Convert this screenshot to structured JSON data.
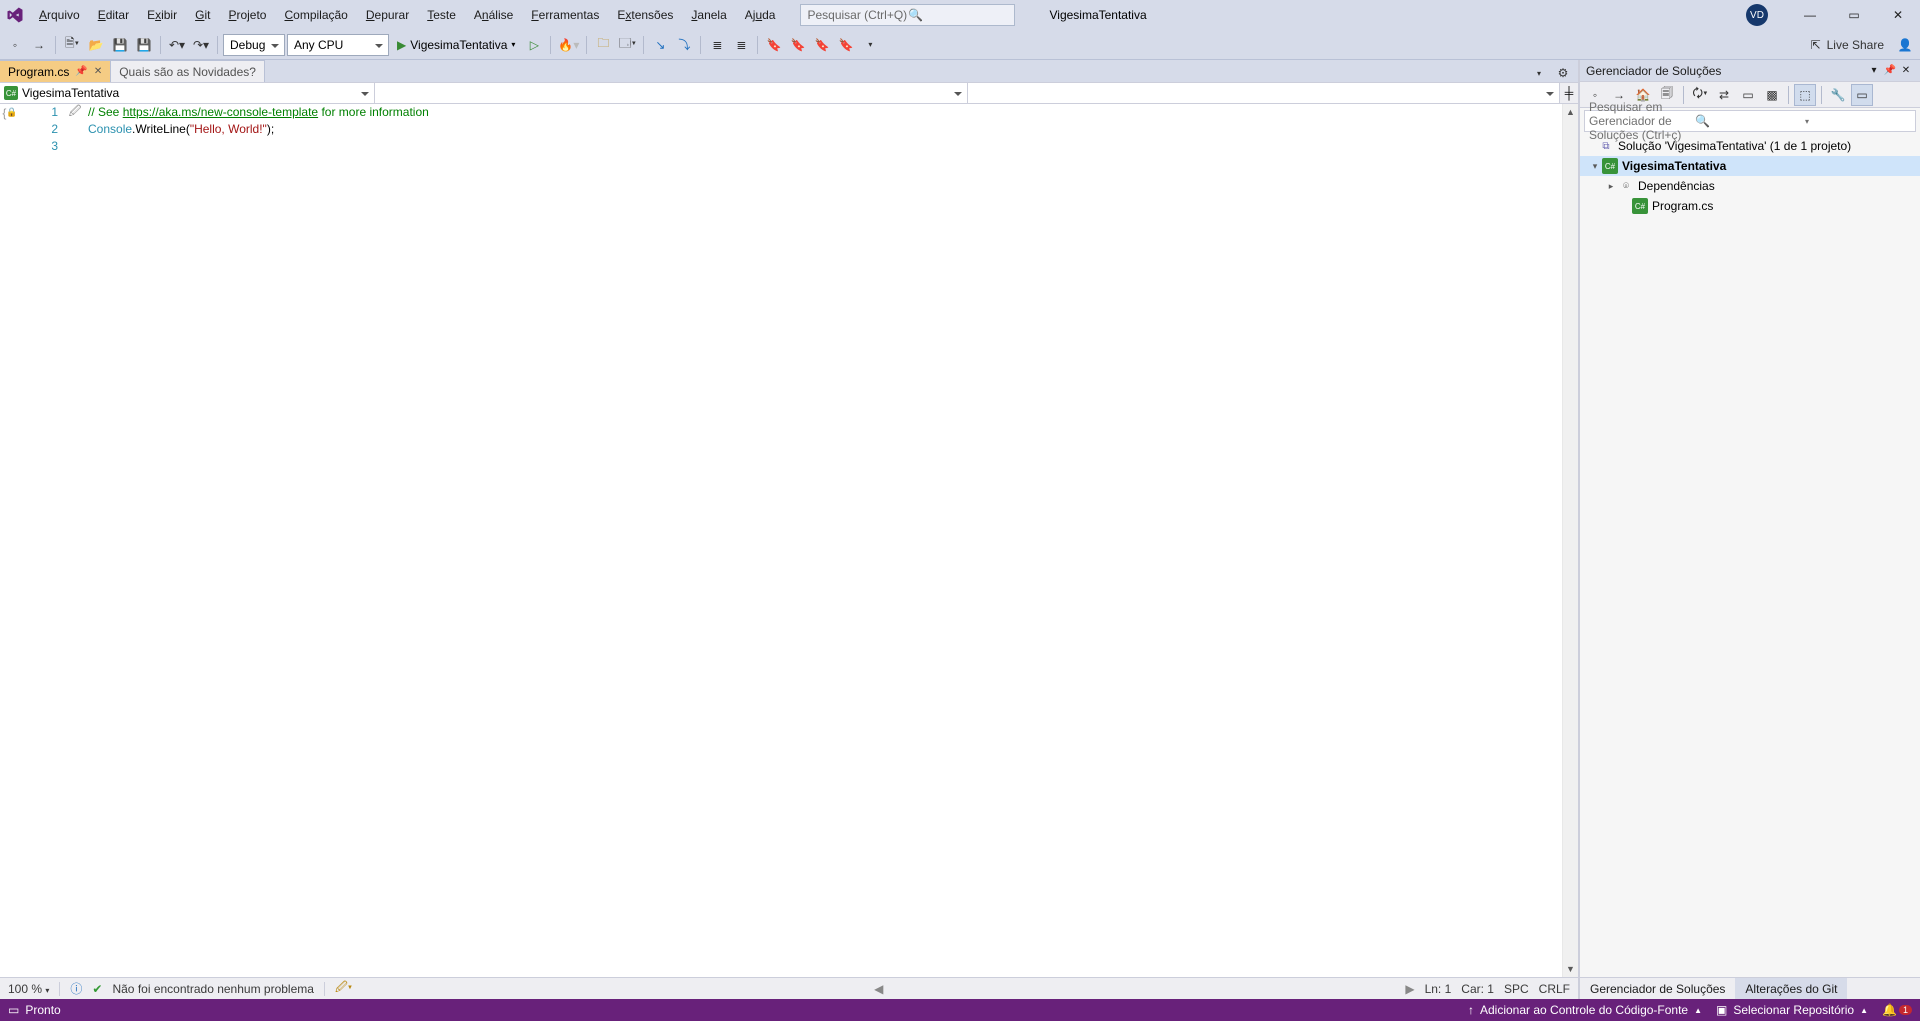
{
  "menu": [
    "Arquivo",
    "Editar",
    "Exibir",
    "Git",
    "Projeto",
    "Compilação",
    "Depurar",
    "Teste",
    "Análise",
    "Ferramentas",
    "Extensões",
    "Janela",
    "Ajuda"
  ],
  "search_placeholder": "Pesquisar (Ctrl+Q)",
  "project_title": "VigesimaTentativa",
  "avatar": "VD",
  "toolbar": {
    "config": "Debug",
    "platform": "Any CPU",
    "run_target": "VigesimaTentativa",
    "live_share": "Live Share"
  },
  "tabs": [
    {
      "label": "Program.cs",
      "active": true,
      "pinned": true
    },
    {
      "label": "Quais são as Novidades?",
      "active": false
    }
  ],
  "nav_combo": "VigesimaTentativa",
  "code": {
    "lines": [
      "1",
      "2",
      "3"
    ],
    "l1_prefix": "// See ",
    "l1_url": "https://aka.ms/new-console-template",
    "l1_suffix": " for more information",
    "l2_class": "Console",
    "l2_mid": ".WriteLine(",
    "l2_str": "\"Hello, World!\"",
    "l2_end": ");"
  },
  "editor_status": {
    "zoom": "100 %",
    "issues": "Não foi encontrado nenhum problema",
    "ln": "Ln: 1",
    "car": "Car: 1",
    "spc": "SPC",
    "crlf": "CRLF"
  },
  "solution_explorer": {
    "title": "Gerenciador de Soluções",
    "search": "Pesquisar em Gerenciador de Soluções (Ctrl+ç)",
    "solution": "Solução 'VigesimaTentativa' (1 de 1 projeto)",
    "project": "VigesimaTentativa",
    "deps": "Dependências",
    "file": "Program.cs",
    "tab1": "Gerenciador de Soluções",
    "tab2": "Alterações do Git"
  },
  "statusbar": {
    "ready": "Pronto",
    "add_source_control": "Adicionar ao Controle do Código-Fonte",
    "select_repo": "Selecionar Repositório",
    "notif_count": "1"
  }
}
